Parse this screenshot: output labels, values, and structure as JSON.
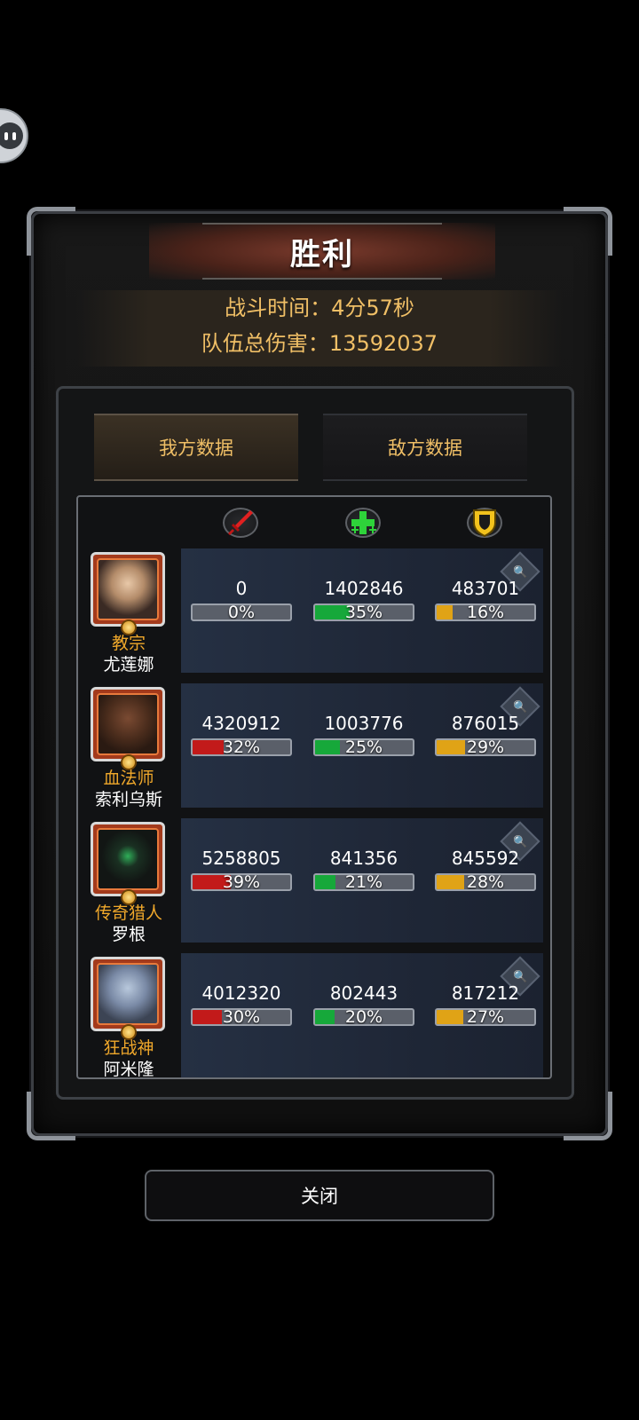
{
  "header": {
    "title": "胜利"
  },
  "summary": {
    "battle_time": "战斗时间：4分57秒",
    "total_damage": "队伍总伤害：13592037"
  },
  "tabs": [
    {
      "label": "我方数据",
      "active": true
    },
    {
      "label": "敌方数据",
      "active": false
    }
  ],
  "column_icons": [
    "sword-icon",
    "heal-cross-icon",
    "shield-icon"
  ],
  "heroes": [
    {
      "class": "教宗",
      "name": "尤莲娜",
      "damage": "0",
      "damage_pct": "0%",
      "damage_frac": 0.0,
      "heal": "1402846",
      "heal_pct": "35%",
      "heal_frac": 0.35,
      "tank": "483701",
      "tank_pct": "16%",
      "tank_frac": 0.16
    },
    {
      "class": "血法师",
      "name": "索利乌斯",
      "damage": "4320912",
      "damage_pct": "32%",
      "damage_frac": 0.32,
      "heal": "1003776",
      "heal_pct": "25%",
      "heal_frac": 0.25,
      "tank": "876015",
      "tank_pct": "29%",
      "tank_frac": 0.29
    },
    {
      "class": "传奇猎人",
      "name": "罗根",
      "damage": "5258805",
      "damage_pct": "39%",
      "damage_frac": 0.39,
      "heal": "841356",
      "heal_pct": "21%",
      "heal_frac": 0.21,
      "tank": "845592",
      "tank_pct": "28%",
      "tank_frac": 0.28
    },
    {
      "class": "狂战神",
      "name": "阿米隆",
      "damage": "4012320",
      "damage_pct": "30%",
      "damage_frac": 0.3,
      "heal": "802443",
      "heal_pct": "20%",
      "heal_frac": 0.2,
      "tank": "817212",
      "tank_pct": "27%",
      "tank_frac": 0.27
    }
  ],
  "footer": {
    "close_label": "关闭"
  }
}
